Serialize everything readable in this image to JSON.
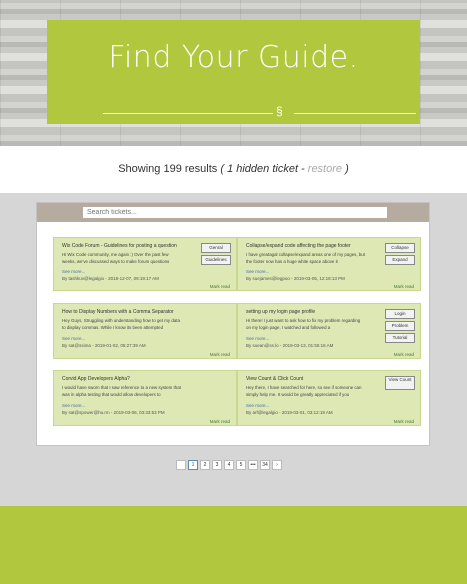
{
  "hero": {
    "title": "Find Your Guide.",
    "symbol": "§"
  },
  "results": {
    "text": "Showing 199 results",
    "hidden": "( 1 hidden ticket - ",
    "restore": "restore",
    "close": " )"
  },
  "search": {
    "placeholder": "Search tickets..."
  },
  "tickets": [
    {
      "title": "Wix Code Forum - Guidelines for posting a question",
      "body": "Hi Wix Code community, me again :) Over the past few weeks, we've discussed ways to make forum questions",
      "more": "See more...",
      "by": "By tashkuv@legalgio - 2018-12-07, 09:19:17 AM",
      "mark": "Mark read",
      "tags": [
        "Genral",
        "Guidelines"
      ]
    },
    {
      "title": "Collapse/expand code affecting the page footer",
      "body": "I have greatagal collapse/expand areas one of my pages, but the footer now has a huge white space above it",
      "more": "See more...",
      "by": "By suejames@legpoo - 2019-03-05, 12:18:13 PM",
      "mark": "Mark read",
      "tags": [
        "Collapse",
        "Expand"
      ]
    },
    {
      "title": "How to Display Numbers with a Comma Separator",
      "body": "Hey Guys, Struggling with understanding how to get my data to display commas. While I know its been attempted",
      "more": "See more...",
      "by": "By sat@ssima - 2019-01-02, 05:27:39 AM",
      "mark": "Mark read",
      "tags": []
    },
    {
      "title": "setting up my login page profile",
      "body": "Hi there! I just want to ask how to fix my problem regarding on my login page. I watched and followed a",
      "more": "See more...",
      "by": "By suean@ss.lo - 2019-03-13, 01:55:16 AM",
      "mark": "Mark read",
      "tags": [
        "Login",
        "Problem",
        "Tutorial"
      ]
    },
    {
      "title": "Corvid App Developers Alpha?",
      "body": "I would have sworn that I saw reference to a new system that was in alpha testing that would allow developers to",
      "more": "See more...",
      "by": "By sat@spower@hu.rm - 2019-03-06, 03:33:53 PM",
      "mark": "Mark read",
      "tags": []
    },
    {
      "title": "View Count & Click Count",
      "body": "Hey there, I have searched for here, so see if someone can simply help me. It would be greatly appreciated if you",
      "more": "See more...",
      "by": "By arf@legalgio - 2019-03-01, 03:12:19 AM",
      "mark": "Mark read",
      "tags": [
        "View Count"
      ]
    }
  ],
  "pagination": [
    "",
    "1",
    "2",
    "3",
    "4",
    "5",
    "•••",
    "34",
    "›"
  ]
}
